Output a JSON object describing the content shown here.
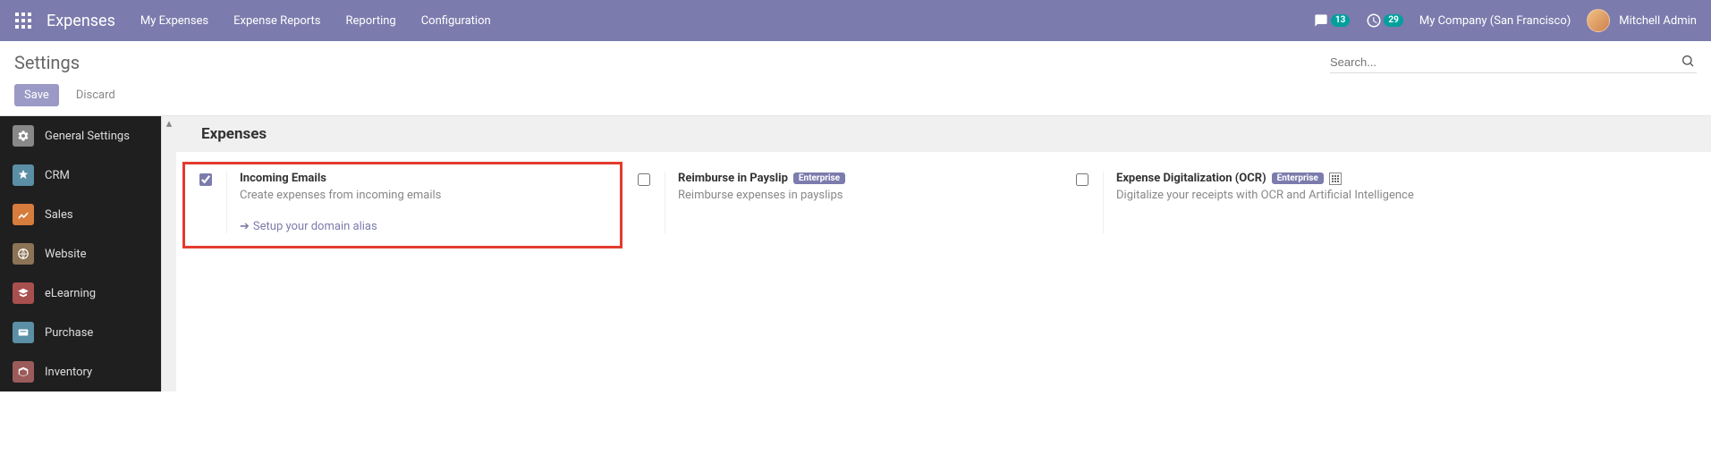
{
  "navbar": {
    "brand": "Expenses",
    "links": [
      "My Expenses",
      "Expense Reports",
      "Reporting",
      "Configuration"
    ],
    "messages_count": "13",
    "activities_count": "29",
    "company": "My Company (San Francisco)",
    "user_name": "Mitchell Admin"
  },
  "control_panel": {
    "title": "Settings",
    "search_placeholder": "Search...",
    "save_label": "Save",
    "discard_label": "Discard"
  },
  "sidebar": {
    "items": [
      {
        "label": "General Settings"
      },
      {
        "label": "CRM"
      },
      {
        "label": "Sales"
      },
      {
        "label": "Website"
      },
      {
        "label": "eLearning"
      },
      {
        "label": "Purchase"
      },
      {
        "label": "Inventory"
      }
    ]
  },
  "settings": {
    "section_title": "Expenses",
    "items": [
      {
        "title": "Incoming Emails",
        "desc": "Create expenses from incoming emails",
        "checked": true,
        "action": "Setup your domain alias",
        "highlight": true
      },
      {
        "title": "Reimburse in Payslip",
        "desc": "Reimburse expenses in payslips",
        "checked": false,
        "enterprise": "Enterprise"
      },
      {
        "title": "Expense Digitalization (OCR)",
        "desc": "Digitalize your receipts with OCR and Artificial Intelligence",
        "checked": false,
        "enterprise": "Enterprise",
        "iap": true
      }
    ]
  }
}
